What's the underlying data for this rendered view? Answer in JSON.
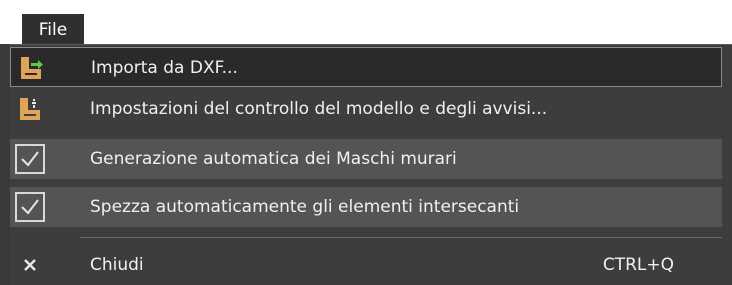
{
  "menubar": {
    "file_label": "File"
  },
  "menu": {
    "items": [
      {
        "label": "Importa da DXF...",
        "icon": "import-dxf-icon",
        "highlighted": true
      },
      {
        "label": "Impostazioni del controllo del modello e degli avvisi...",
        "icon": "model-check-settings-icon"
      },
      {
        "label": "Generazione automatica dei Maschi murari",
        "icon": "check-icon",
        "checked": true
      },
      {
        "label": "Spezza automaticamente gli elementi intersecanti",
        "icon": "check-icon",
        "checked": true
      },
      {
        "label": "Chiudi",
        "icon": "close-icon",
        "shortcut": "CTRL+Q"
      }
    ]
  },
  "colors": {
    "menu_background": "#3d3d3d",
    "highlight_background": "#2a2a2a",
    "toggle_row_background": "#545454",
    "icon_orange": "#e0a357",
    "icon_green": "#5cc94a",
    "text": "#f0f0f0"
  }
}
